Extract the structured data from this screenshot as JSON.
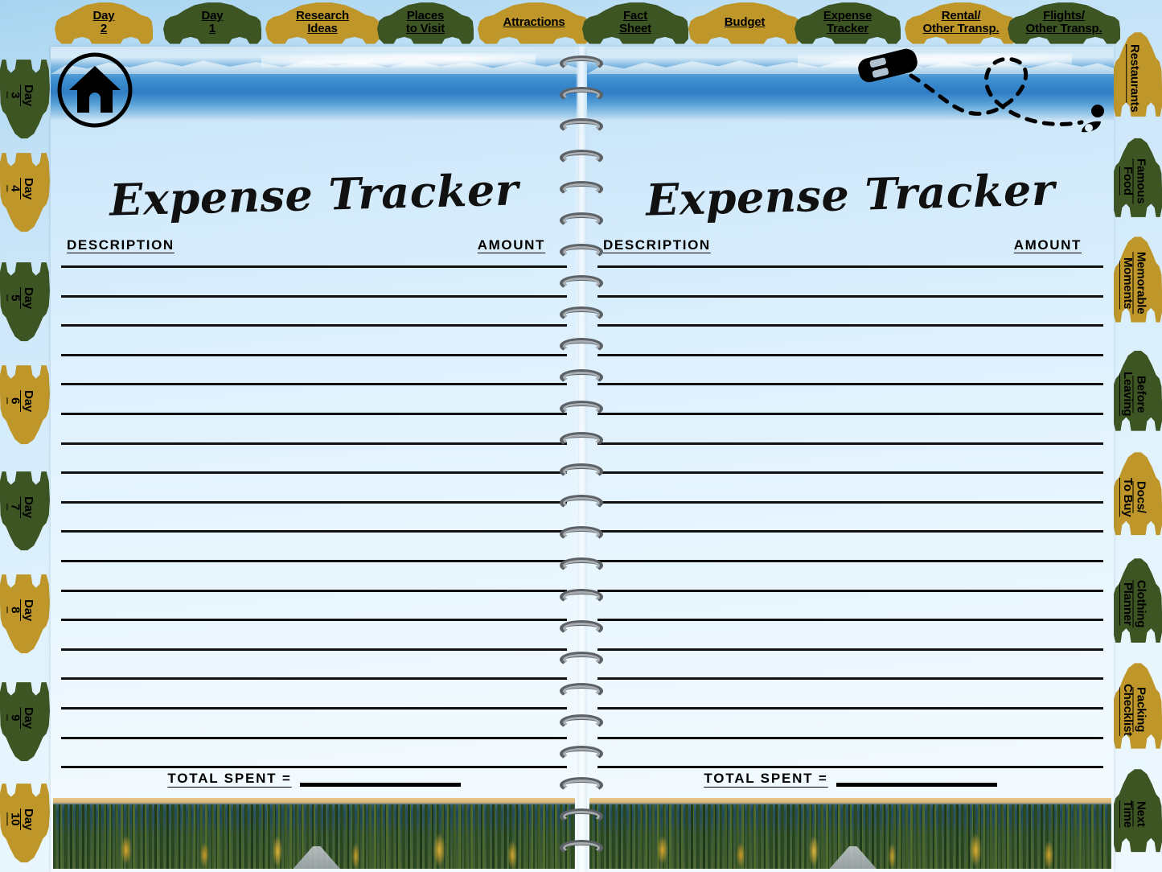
{
  "document": {
    "kind": "travel-planner-spread",
    "background_color": "#cfe8fa"
  },
  "colors": {
    "tab_gold": "#be962a",
    "tab_green": "#3d5423",
    "ink": "#111111",
    "page": "#dff1fd"
  },
  "top_tabs": [
    {
      "label": "Day\n2",
      "color": "gold",
      "name": "tab-day-2"
    },
    {
      "label": "Day\n1",
      "color": "green",
      "name": "tab-day-1"
    },
    {
      "label": "Research\nIdeas",
      "color": "gold",
      "name": "tab-research-ideas"
    },
    {
      "label": "Places\nto Visit",
      "color": "green",
      "name": "tab-places-to-visit"
    },
    {
      "label": "Attractions",
      "color": "gold",
      "name": "tab-attractions"
    },
    {
      "label": "Fact\nSheet",
      "color": "green",
      "name": "tab-fact-sheet"
    },
    {
      "label": "Budget",
      "color": "gold",
      "name": "tab-budget"
    },
    {
      "label": "Expense\nTracker",
      "color": "green",
      "name": "tab-expense-tracker"
    },
    {
      "label": "Rental/\nOther Transp.",
      "color": "gold",
      "name": "tab-rental-other-transp"
    },
    {
      "label": "Flights/\nOther Transp.",
      "color": "green",
      "name": "tab-flights-other-transp"
    }
  ],
  "left_tabs": [
    {
      "label": "Day\n3",
      "color": "green",
      "name": "tab-day-3"
    },
    {
      "label": "Day\n4",
      "color": "gold",
      "name": "tab-day-4"
    },
    {
      "label": "Day\n5",
      "color": "green",
      "name": "tab-day-5"
    },
    {
      "label": "Day\n6",
      "color": "gold",
      "name": "tab-day-6"
    },
    {
      "label": "Day\n7",
      "color": "green",
      "name": "tab-day-7"
    },
    {
      "label": "Day\n8",
      "color": "gold",
      "name": "tab-day-8"
    },
    {
      "label": "Day\n9",
      "color": "green",
      "name": "tab-day-9"
    },
    {
      "label": "Day\n10",
      "color": "gold",
      "name": "tab-day-10"
    }
  ],
  "right_tabs": [
    {
      "label": "Restaurants",
      "color": "gold",
      "name": "tab-restaurants"
    },
    {
      "label": "Famous\nFood",
      "color": "green",
      "name": "tab-famous-food"
    },
    {
      "label": "Memorable\nMoments",
      "color": "gold",
      "name": "tab-memorable-moments"
    },
    {
      "label": "Before\nLeaving",
      "color": "green",
      "name": "tab-before-leaving"
    },
    {
      "label": "Docs/\nTo Buy",
      "color": "gold",
      "name": "tab-docs-to-buy"
    },
    {
      "label": "Clothing\nPlanner",
      "color": "green",
      "name": "tab-clothing-planner"
    },
    {
      "label": "Packing\nChecklist",
      "color": "gold",
      "name": "tab-packing-checklist"
    },
    {
      "label": "Next\nTime",
      "color": "green",
      "name": "tab-next-time"
    }
  ],
  "left_page": {
    "title": "Expense Tracker",
    "column_description": "DESCRIPTION",
    "column_amount": "AMOUNT",
    "total_label": "TOTAL SPENT =",
    "total_value": "",
    "rule_count": 18,
    "rows": [
      {
        "description": "",
        "amount": ""
      },
      {
        "description": "",
        "amount": ""
      },
      {
        "description": "",
        "amount": ""
      },
      {
        "description": "",
        "amount": ""
      },
      {
        "description": "",
        "amount": ""
      },
      {
        "description": "",
        "amount": ""
      },
      {
        "description": "",
        "amount": ""
      },
      {
        "description": "",
        "amount": ""
      },
      {
        "description": "",
        "amount": ""
      },
      {
        "description": "",
        "amount": ""
      },
      {
        "description": "",
        "amount": ""
      },
      {
        "description": "",
        "amount": ""
      },
      {
        "description": "",
        "amount": ""
      },
      {
        "description": "",
        "amount": ""
      },
      {
        "description": "",
        "amount": ""
      },
      {
        "description": "",
        "amount": ""
      },
      {
        "description": "",
        "amount": ""
      },
      {
        "description": "",
        "amount": ""
      }
    ],
    "header_photo": "snowy-mountain-range",
    "footer_photo": "boreal-forest-highway"
  },
  "right_page": {
    "title": "Expense Tracker",
    "column_description": "DESCRIPTION",
    "column_amount": "AMOUNT",
    "total_label": "TOTAL SPENT =",
    "total_value": "",
    "rule_count": 18,
    "rows": [
      {
        "description": "",
        "amount": ""
      },
      {
        "description": "",
        "amount": ""
      },
      {
        "description": "",
        "amount": ""
      },
      {
        "description": "",
        "amount": ""
      },
      {
        "description": "",
        "amount": ""
      },
      {
        "description": "",
        "amount": ""
      },
      {
        "description": "",
        "amount": ""
      },
      {
        "description": "",
        "amount": ""
      },
      {
        "description": "",
        "amount": ""
      },
      {
        "description": "",
        "amount": ""
      },
      {
        "description": "",
        "amount": ""
      },
      {
        "description": "",
        "amount": ""
      },
      {
        "description": "",
        "amount": ""
      },
      {
        "description": "",
        "amount": ""
      },
      {
        "description": "",
        "amount": ""
      },
      {
        "description": "",
        "amount": ""
      },
      {
        "description": "",
        "amount": ""
      },
      {
        "description": "",
        "amount": ""
      }
    ],
    "header_photo": "snowy-mountain-range",
    "footer_photo": "boreal-forest-highway"
  },
  "icons": {
    "home": "home-icon",
    "car": "car-top-view-icon",
    "route": "dashed-route-path",
    "pin": "map-pin-icon",
    "binding": "spiral-binding"
  },
  "binding": {
    "ring_count": 26
  }
}
